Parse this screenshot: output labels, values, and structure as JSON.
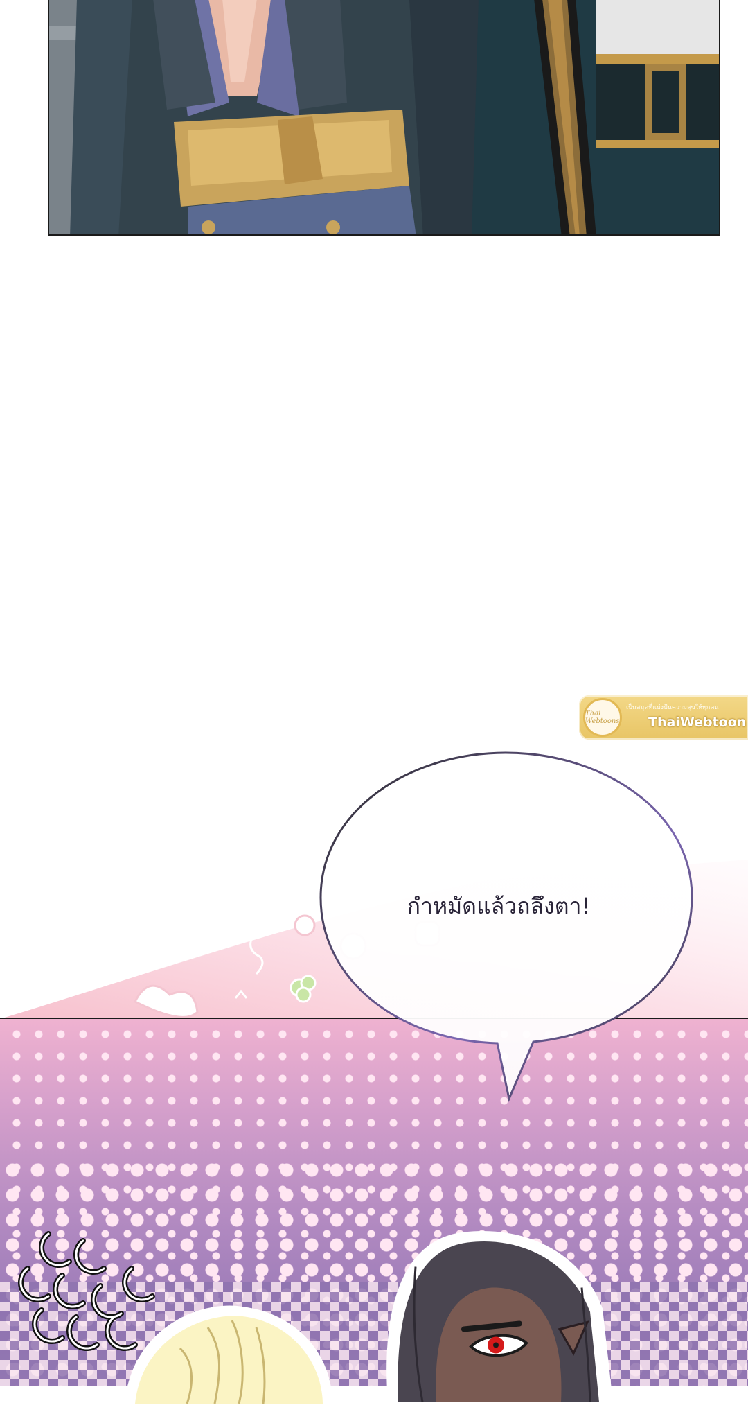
{
  "speech_bubble": {
    "text": "กำหมัดแล้วถลึงตา!"
  },
  "watermark": {
    "logo_text": "Thai Webtoons",
    "tagline": "เป็นสมุดที่แบ่งปันความสุขให้ทุกคน",
    "brand": "ThaiWebtoon"
  },
  "colors": {
    "pink_panel_top": "#efb2d0",
    "purple_panel_bottom": "#9a7ab7",
    "bubble_outline": "#6a5a9c",
    "watermark_gold": "#e8c565"
  }
}
